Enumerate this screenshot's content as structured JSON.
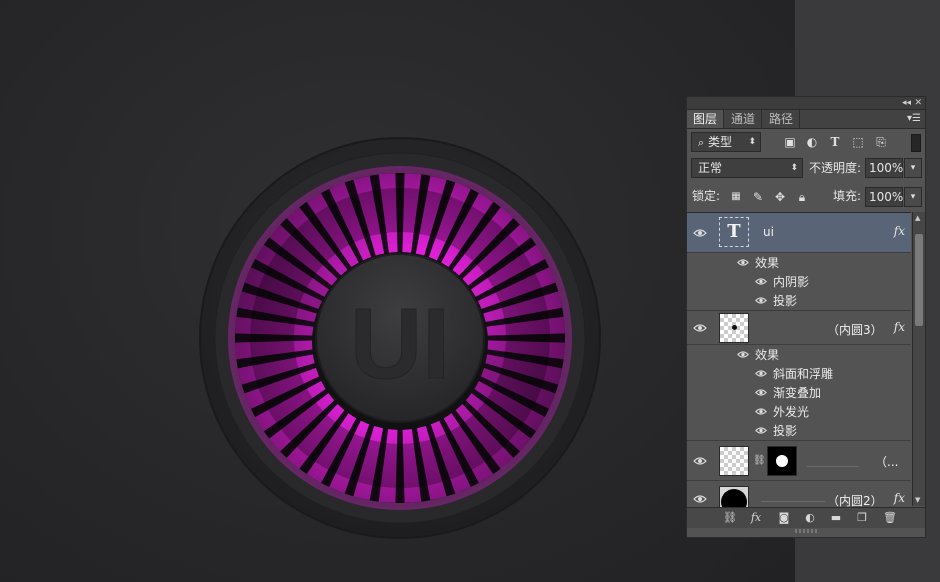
{
  "dial": {
    "logo_text": "UI",
    "accent_color": "#e020d8",
    "stripe_count": 40
  },
  "panel": {
    "tabs": [
      {
        "label": "图层",
        "active": true
      },
      {
        "label": "通道",
        "active": false
      },
      {
        "label": "路径",
        "active": false
      }
    ],
    "filter": {
      "kind_label": "类型"
    },
    "blend_mode": "正常",
    "opacity_label": "不透明度:",
    "opacity_value": "100%",
    "lock_label": "锁定:",
    "fill_label": "填充:",
    "fill_value": "100%",
    "layers": [
      {
        "name": "ui",
        "type": "text",
        "selected": true,
        "fx": "fx",
        "effects_label": "效果",
        "effects": [
          "内阴影",
          "投影"
        ]
      },
      {
        "name": "（内圆3）",
        "type": "shape",
        "selected": false,
        "fx": "fx",
        "effects_label": "效果",
        "effects": [
          "斜面和浮雕",
          "渐变叠加",
          "外发光",
          "投影"
        ]
      },
      {
        "name": "（...",
        "type": "masked",
        "selected": false,
        "fx": ""
      },
      {
        "name": "（内圆2）",
        "type": "shape-black",
        "selected": false,
        "fx": "fx"
      }
    ]
  }
}
